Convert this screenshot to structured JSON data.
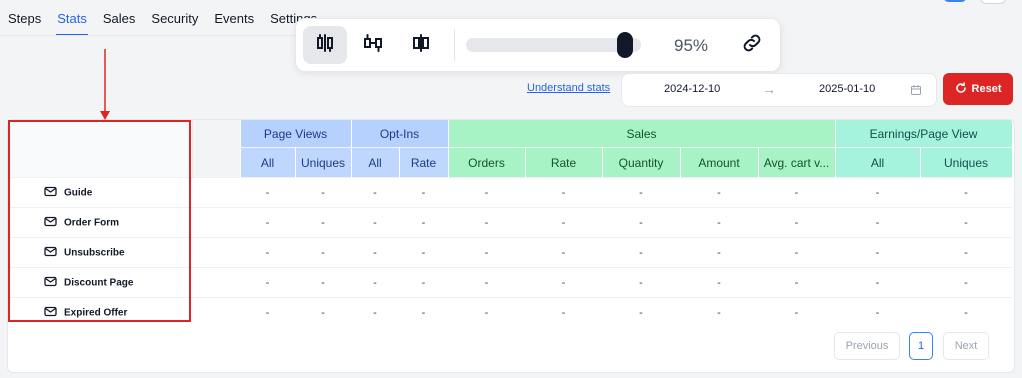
{
  "tabs": [
    "Steps",
    "Stats",
    "Sales",
    "Security",
    "Events",
    "Settings"
  ],
  "active_tab": "Stats",
  "toolbar": {
    "view_icons": [
      "split-view-icon",
      "compare-view-icon",
      "merge-view-icon"
    ],
    "zoom_value": 95,
    "zoom_label": "95%",
    "link_icon": "link-icon"
  },
  "filters": {
    "understand_link": "Understand stats",
    "start_date": "2024-12-10",
    "arrow": "→",
    "end_date": "2025-01-10",
    "reset_label": "Reset"
  },
  "table": {
    "groups": {
      "page_views": "Page Views",
      "opt_ins": "Opt-Ins",
      "sales": "Sales",
      "epv": "Earnings/Page View"
    },
    "columns": [
      "All",
      "Uniques",
      "All",
      "Rate",
      "Orders",
      "Rate",
      "Quantity",
      "Amount",
      "Avg. cart v...",
      "All",
      "Uniques"
    ],
    "rows": [
      {
        "name": "Guide",
        "values": [
          "-",
          "-",
          "-",
          "-",
          "-",
          "-",
          "-",
          "-",
          "-",
          "-",
          "-"
        ]
      },
      {
        "name": "Order Form",
        "values": [
          "-",
          "-",
          "-",
          "-",
          "-",
          "-",
          "-",
          "-",
          "-",
          "-",
          "-"
        ]
      },
      {
        "name": "Unsubscribe",
        "values": [
          "-",
          "-",
          "-",
          "-",
          "-",
          "-",
          "-",
          "-",
          "-",
          "-",
          "-"
        ]
      },
      {
        "name": "Discount Page",
        "values": [
          "-",
          "-",
          "-",
          "-",
          "-",
          "-",
          "-",
          "-",
          "-",
          "-",
          "-"
        ]
      },
      {
        "name": "Expired Offer",
        "values": [
          "-",
          "-",
          "-",
          "-",
          "-",
          "-",
          "-",
          "-",
          "-",
          "-",
          "-"
        ]
      }
    ]
  },
  "pagination": {
    "previous": "Previous",
    "page": "1",
    "next": "Next"
  },
  "colors": {
    "accent": "#2563eb",
    "reset": "#dc2626",
    "annotation": "#dc2626"
  }
}
